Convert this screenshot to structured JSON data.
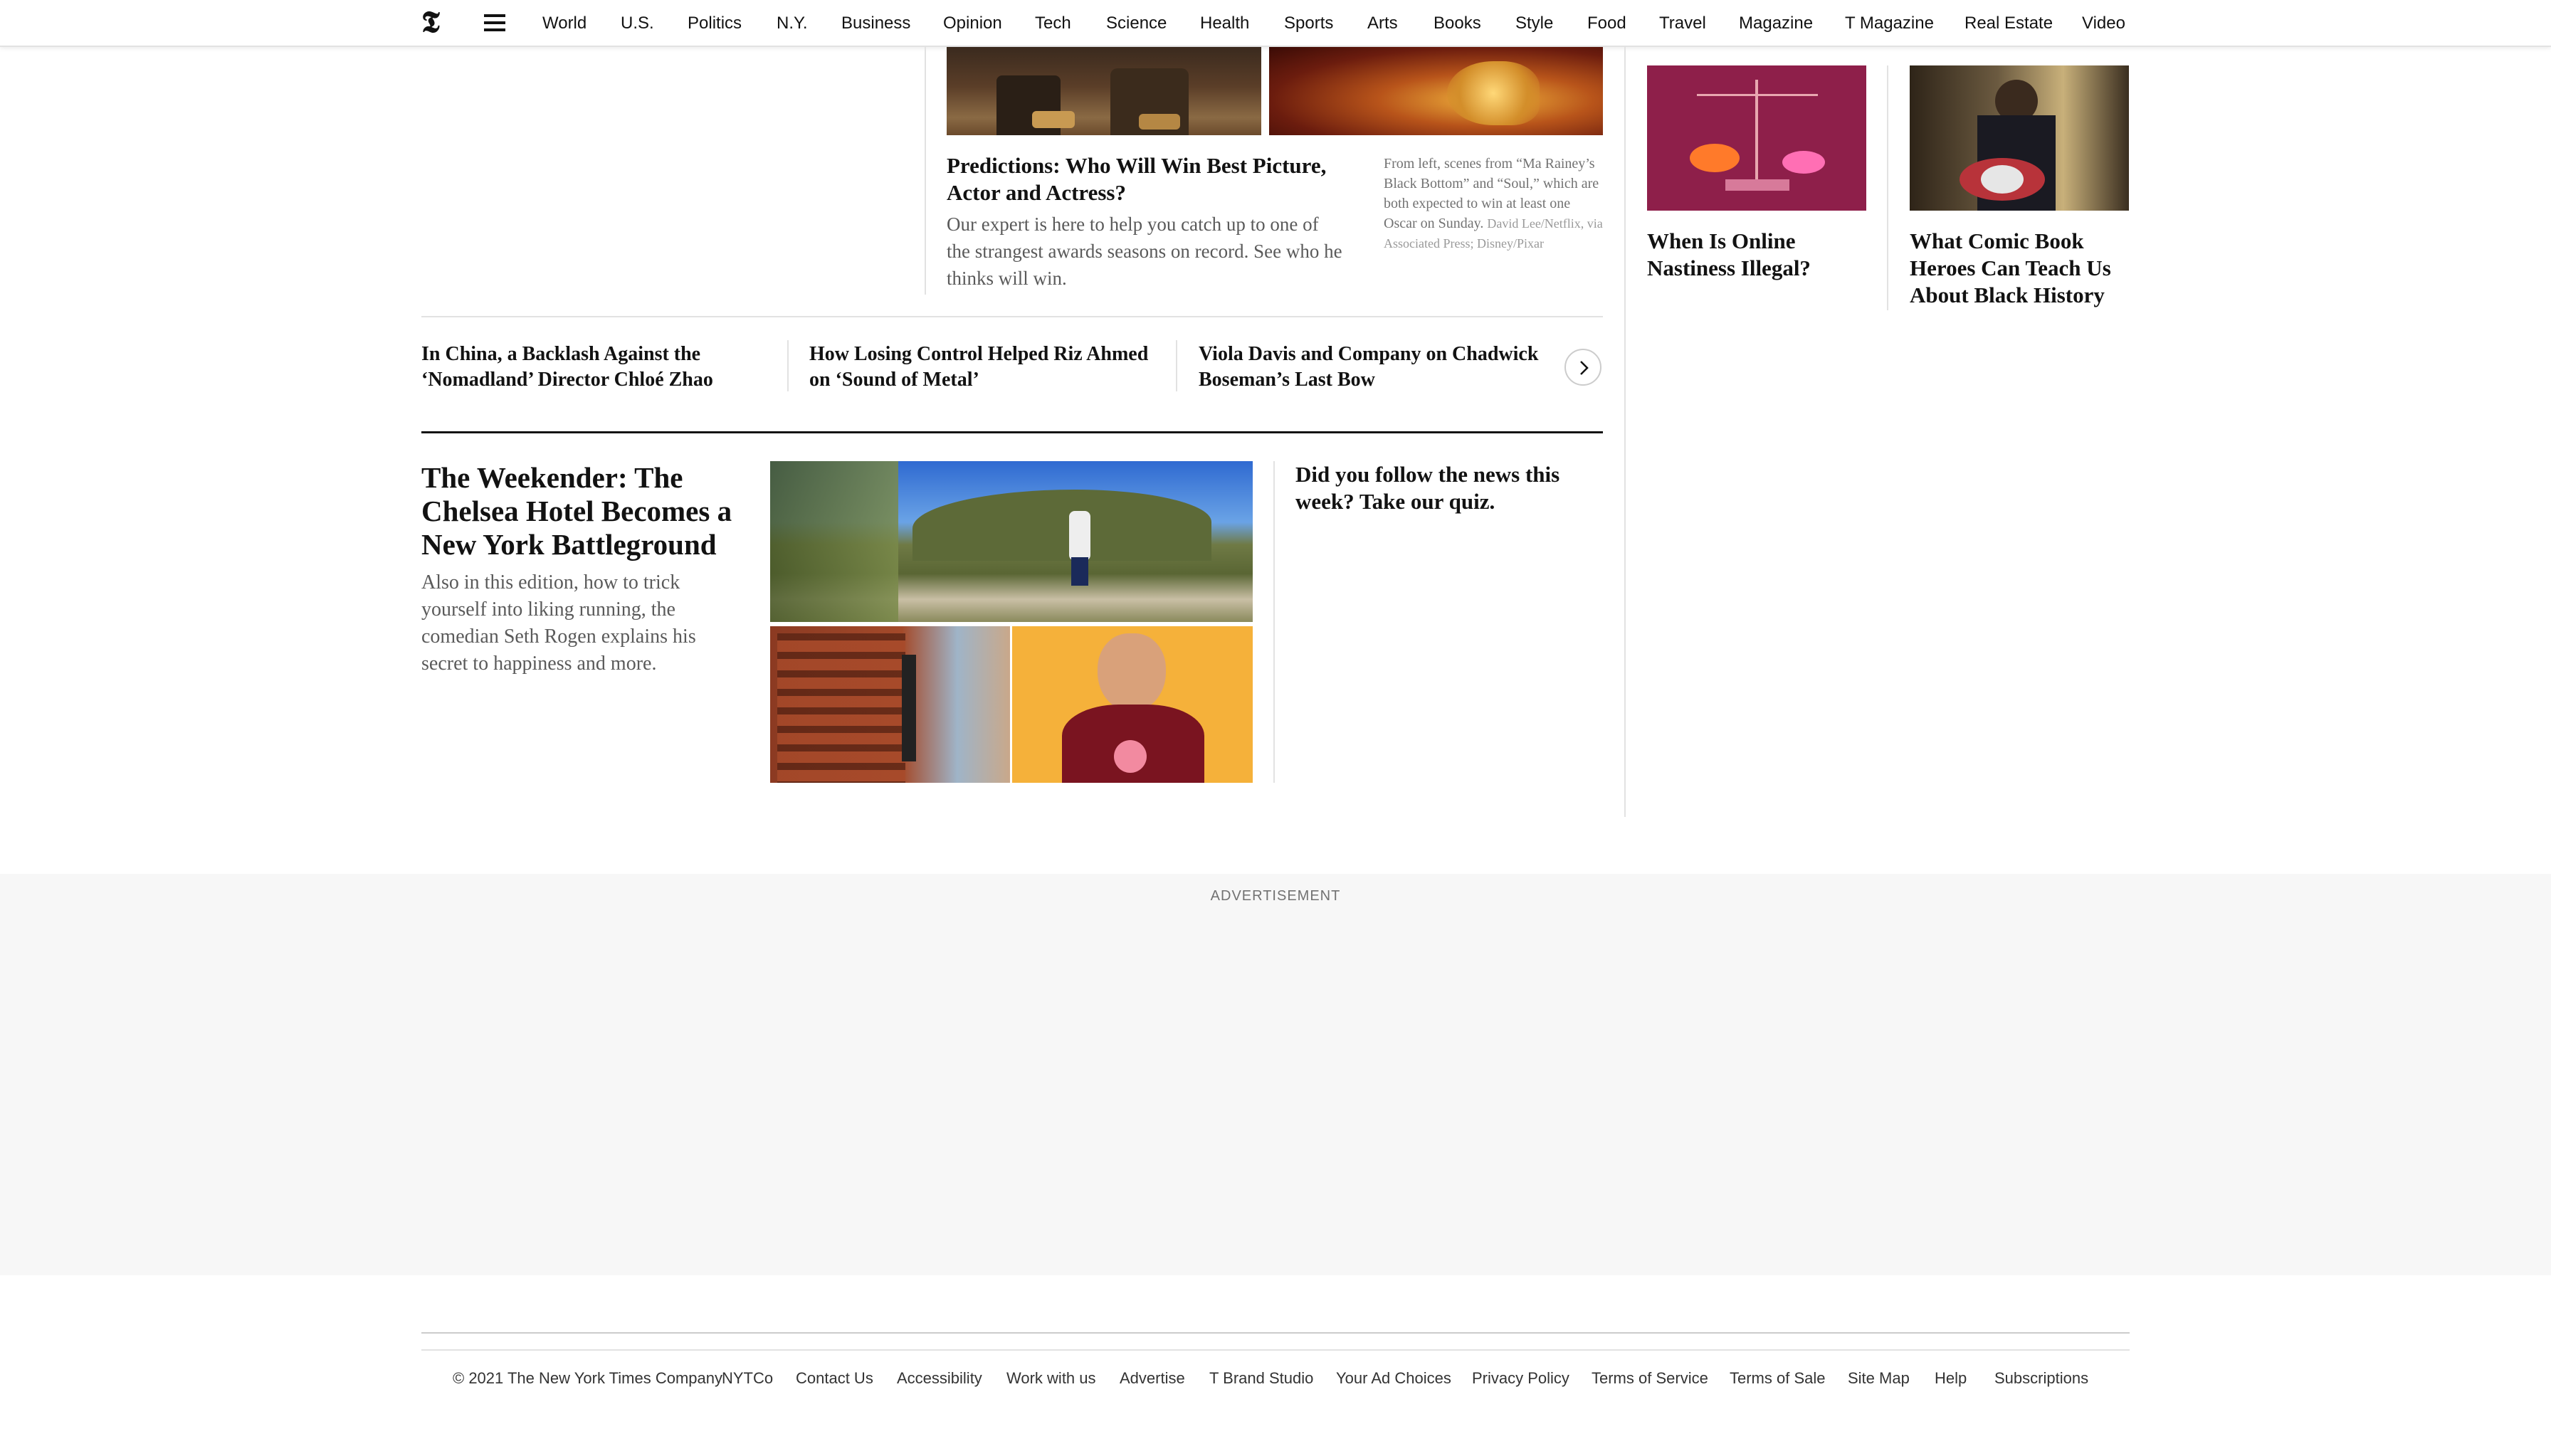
{
  "nav": {
    "items": [
      "World",
      "U.S.",
      "Politics",
      "N.Y.",
      "Business",
      "Opinion",
      "Tech",
      "Science",
      "Health",
      "Sports",
      "Arts",
      "Books",
      "Style",
      "Food",
      "Travel",
      "Magazine",
      "T Magazine",
      "Real Estate",
      "Video"
    ]
  },
  "oscars": {
    "headline": "Predictions: Who Will Win Best Picture, Actor and Actress?",
    "summary": "Our expert is here to help you catch up to one of the strangest awards seasons on record. See who he thinks will win.",
    "caption": "From left, scenes from “Ma Rainey’s Black Bottom” and “Soul,” which are both expected to win at least one Oscar on Sunday.",
    "credit": "David Lee/Netflix, via Associated Press; Disney/Pixar"
  },
  "carousel": {
    "items": [
      "In China, a Backlash Against the ‘Nomadland’ Director Chloé Zhao",
      "How Losing Control Helped Riz Ahmed on ‘Sound of Metal’",
      "Viola Davis and Company on Chadwick Boseman’s Last Bow"
    ]
  },
  "weekender": {
    "headline": "The Weekender: The Chelsea Hotel Becomes a New York Battleground",
    "summary": "Also in this edition, how to trick yourself into liking running, the comedian Seth Rogen explains his secret to happiness and more."
  },
  "quiz": {
    "headline": "Did you follow the news this week? Take our quiz."
  },
  "sidebar": {
    "story1": "When Is Online Nastiness Illegal?",
    "story2": "What Comic Book Heroes Can Teach Us About Black History"
  },
  "ad": {
    "label": "ADVERTISEMENT"
  },
  "footer": {
    "copyright": "© 2021 The New York Times Company",
    "links": [
      "NYTCo",
      "Contact Us",
      "Accessibility",
      "Work with us",
      "Advertise",
      "T Brand Studio",
      "Your Ad Choices",
      "Privacy Policy",
      "Terms of Service",
      "Terms of Sale",
      "Site Map",
      "Help",
      "Subscriptions"
    ]
  },
  "colors": {
    "text": "#121212",
    "summary": "#5a5a5a",
    "rule": "#e2e2e2",
    "ad_bg": "#f7f7f7"
  }
}
